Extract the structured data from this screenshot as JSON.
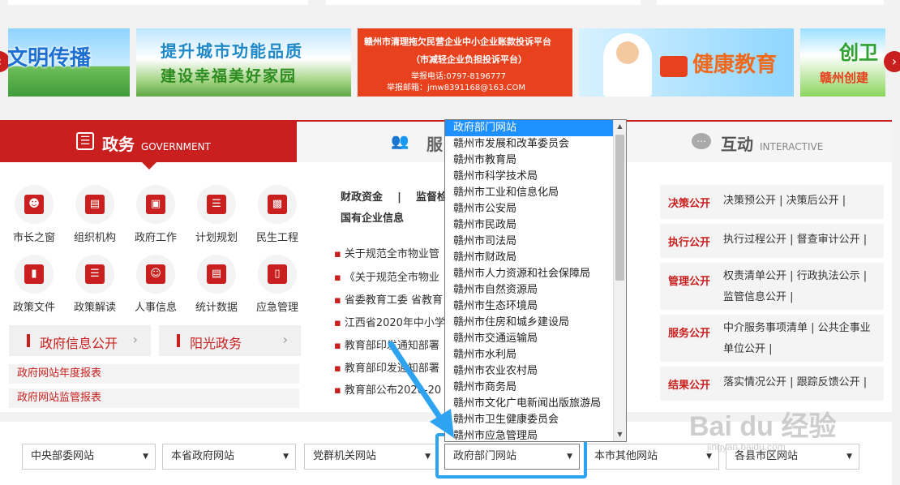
{
  "banners": {
    "b1": "文明传播",
    "b2_line1": "提升城市功能品质",
    "b2_line2": "建设幸福美好家园",
    "b3_line1": "赣州市清理拖欠民营企业中小企业账款投诉平台",
    "b3_line2": "（市减轻企业负担投诉平台）",
    "b3_line3": "举报电话:0797-8196777",
    "b3_line4": "举报邮箱：jmw8391168@163.COM",
    "b4": "健康教育",
    "b5_line1": "创卫",
    "b5_line2": "赣州创建"
  },
  "tabs": {
    "gov_cn": "政务",
    "gov_en": "GOVERNMENT",
    "service_cn": "服",
    "interactive_cn": "互动",
    "interactive_en": "INTERACTIVE"
  },
  "grid": [
    {
      "label": "市长之窗",
      "icon": "person-icon"
    },
    {
      "label": "组织机构",
      "icon": "building-icon"
    },
    {
      "label": "政府工作",
      "icon": "briefcase-icon"
    },
    {
      "label": "计划规划",
      "icon": "layers-icon"
    },
    {
      "label": "民生工程",
      "icon": "newspaper-icon"
    },
    {
      "label": "政策文件",
      "icon": "binders-icon"
    },
    {
      "label": "政策解读",
      "icon": "document-icon"
    },
    {
      "label": "人事信息",
      "icon": "id-card-icon"
    },
    {
      "label": "统计数据",
      "icon": "monitor-icon"
    },
    {
      "label": "应急管理",
      "icon": "folder-icon"
    }
  ],
  "pill_buttons": {
    "info_open": "政府信息公开",
    "sunshine": "阳光政务"
  },
  "red_links": {
    "annual_report": "政府网站年度报表",
    "monitor_report": "政府网站监管报表"
  },
  "middle": {
    "head_a": "财政资金",
    "head_sep": "|",
    "head_b": "监督检查",
    "head_c": "国有企业信息",
    "news": [
      "关于规范全市物业管",
      "《关于规范全市物业",
      "省委教育工委 省教育",
      "江西省2020年中小学",
      "教育部印发通知部署",
      "教育部印发通知部署",
      "教育部公布2020-20"
    ]
  },
  "right": {
    "rows": [
      {
        "key": "决策公开",
        "value": "决策预公开 | 决策后公开 |"
      },
      {
        "key": "执行公开",
        "value": "执行过程公开 | 督查审计公开 |"
      },
      {
        "key": "管理公开",
        "value": "权责清单公开 | 行政执法公示 | 监管信息公开 |"
      },
      {
        "key": "服务公开",
        "value": "中介服务事项清单 | 公共企事业单位公开 |"
      },
      {
        "key": "结果公开",
        "value": "落实情况公开 | 跟踪反馈公开 |"
      }
    ]
  },
  "dropdown": {
    "items": [
      "政府部门网站",
      "赣州市发展和改革委员会",
      "赣州市教育局",
      "赣州市科学技术局",
      "赣州市工业和信息化局",
      "赣州市公安局",
      "赣州市民政局",
      "赣州市司法局",
      "赣州市财政局",
      "赣州市人力资源和社会保障局",
      "赣州市自然资源局",
      "赣州市生态环境局",
      "赣州市住房和城乡建设局",
      "赣州市交通运输局",
      "赣州市水利局",
      "赣州市农业农村局",
      "赣州市商务局",
      "赣州市文化广电新闻出版旅游局",
      "赣州市卫生健康委员会",
      "赣州市应急管理局"
    ],
    "selected_index": 0
  },
  "selects": {
    "central": "中央部委网站",
    "province": "本省政府网站",
    "party": "党群机关网站",
    "dept": "政府部门网站",
    "other": "本市其他网站",
    "county": "各县市区网站"
  },
  "watermark": {
    "brand": "Bai du 经验",
    "url": "jingyan.baidu.com"
  },
  "colors": {
    "brand_red": "#c9201f",
    "highlight_blue": "#2ea3f2",
    "selection_blue": "#1e90ff"
  }
}
